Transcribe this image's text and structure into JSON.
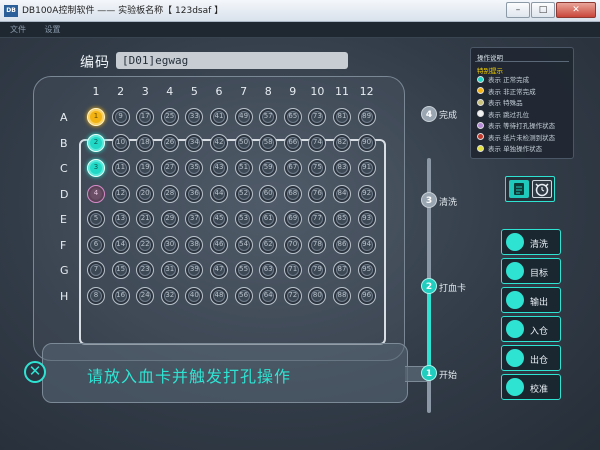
{
  "window": {
    "title": "DB100A控制软件 —— 实验板名称【 123dsaf 】",
    "icon_text": "DB",
    "minimize": "–",
    "maximize": "□",
    "close": "✕"
  },
  "menu": [
    "文件",
    "设置"
  ],
  "code": {
    "label": "编码",
    "value": "[D01]egwag"
  },
  "plate": {
    "columns": [
      "1",
      "2",
      "3",
      "4",
      "5",
      "6",
      "7",
      "8",
      "9",
      "10",
      "11",
      "12"
    ],
    "rows": [
      "A",
      "B",
      "C",
      "D",
      "E",
      "F",
      "G",
      "H"
    ],
    "well_numbers_shown": true,
    "states": {
      "1": "done-abnormal",
      "2": "done-normal",
      "3": "done-normal",
      "4": "punching"
    }
  },
  "steps": [
    {
      "num": "4",
      "label": "完成"
    },
    {
      "num": "3",
      "label": "清洗"
    },
    {
      "num": "2",
      "label": "打血卡"
    },
    {
      "num": "1",
      "label": "开始"
    }
  ],
  "progress": {
    "active_steps": [
      "1",
      "2"
    ]
  },
  "message": {
    "text": "请放入血卡并触发打孔操作",
    "cancel_icon": "✕"
  },
  "legend": {
    "title": "操作说明",
    "subtitle": "特别提示",
    "items": [
      {
        "label": "表示 正常完成",
        "color": "#21d7c5"
      },
      {
        "label": "表示 非正常完成",
        "color": "#f3b312"
      },
      {
        "label": "表示 特殊品",
        "color": "#c9c27a"
      },
      {
        "label": "表示 跳过孔位",
        "color": "#f2f2f2"
      },
      {
        "label": "表示 等待打孔操作状态",
        "color": "#b58ad6"
      },
      {
        "label": "表示 纸片未检测到状态",
        "color": "#c0392b"
      },
      {
        "label": "表示 单独操作状态",
        "color": "#e4e13c"
      }
    ]
  },
  "mode_toggle": {
    "list_icon": "list-icon",
    "clock_icon": "alarm-clock-icon"
  },
  "actions": [
    {
      "label": "清洗",
      "icon": "wash-icon"
    },
    {
      "label": "目标",
      "icon": "target-icon"
    },
    {
      "label": "输出",
      "icon": "undo-icon"
    },
    {
      "label": "入仓",
      "icon": "tray-in-icon"
    },
    {
      "label": "出仓",
      "icon": "tray-out-icon"
    },
    {
      "label": "校准",
      "icon": "calibrate-icon"
    }
  ],
  "colors": {
    "accent": "#2fe3d3",
    "done_normal": "#21d7c5",
    "done_abnormal": "#f3b312",
    "punching": "#d78ac8"
  }
}
